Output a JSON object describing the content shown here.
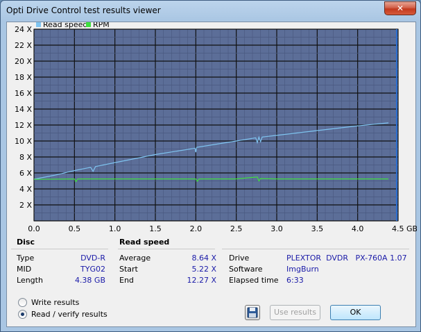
{
  "window": {
    "title": "Opti Drive Control test results viewer",
    "close_label": "✕"
  },
  "chart_data": {
    "type": "line",
    "legend": [
      {
        "name": "Read speed",
        "color": "#7fc4f0"
      },
      {
        "name": "RPM",
        "color": "#3fe03f"
      }
    ],
    "legend_position": "top-left",
    "y_ticks": [
      "24 X",
      "22 X",
      "20 X",
      "18 X",
      "16 X",
      "14 X",
      "12 X",
      "10 X",
      "8 X",
      "6 X",
      "4 X",
      "2 X"
    ],
    "x_ticks": [
      "0.0",
      "0.5",
      "1.0",
      "1.5",
      "2.0",
      "2.5",
      "3.0",
      "3.5",
      "4.0",
      "4.5 GB"
    ],
    "xlim": [
      0,
      4.5
    ],
    "ylim": [
      0,
      24
    ],
    "grid": true,
    "background_color": "#5c6e98",
    "series": [
      {
        "name": "Read speed",
        "x": [
          0.0,
          0.25,
          0.5,
          0.7,
          0.73,
          0.76,
          1.0,
          1.5,
          1.99,
          2.0,
          2.01,
          2.5,
          2.74,
          2.76,
          2.78,
          2.8,
          2.82,
          3.0,
          3.5,
          4.0,
          4.38
        ],
        "y": [
          5.22,
          5.7,
          6.3,
          6.7,
          6.2,
          6.8,
          7.3,
          8.3,
          9.1,
          8.6,
          9.2,
          10.0,
          10.4,
          9.8,
          10.5,
          9.9,
          10.5,
          10.7,
          11.3,
          11.9,
          12.27
        ]
      },
      {
        "name": "RPM",
        "x": [
          0.0,
          0.5,
          0.52,
          0.54,
          1.0,
          1.5,
          2.0,
          2.02,
          2.04,
          2.5,
          2.76,
          2.78,
          2.8,
          3.0,
          3.5,
          4.0,
          4.38
        ],
        "y": [
          5.2,
          5.25,
          4.9,
          5.25,
          5.25,
          5.25,
          5.25,
          4.95,
          5.25,
          5.25,
          5.5,
          5.0,
          5.3,
          5.25,
          5.25,
          5.25,
          5.25
        ]
      }
    ]
  },
  "disc": {
    "header": "Disc",
    "rows": [
      {
        "label": "Type",
        "value": "DVD-R"
      },
      {
        "label": "MID",
        "value": "TYG02"
      },
      {
        "label": "Length",
        "value": "4.38 GB"
      }
    ]
  },
  "read_speed": {
    "header": "Read speed",
    "rows": [
      {
        "label": "Average",
        "value": "8.64 X"
      },
      {
        "label": "Start",
        "value": "5.22 X"
      },
      {
        "label": "End",
        "value": "12.27 X"
      }
    ]
  },
  "drive_info": {
    "rows": [
      {
        "label": "Drive",
        "value": "PLEXTOR  DVDR   PX-760A 1.07"
      },
      {
        "label": "Software",
        "value": "ImgBurn"
      },
      {
        "label": "Elapsed time",
        "value": "6:33"
      }
    ]
  },
  "mode": {
    "write_label": "Write results",
    "read_label": "Read / verify results",
    "selected": "read"
  },
  "buttons": {
    "save_icon": "floppy-disk-icon",
    "use_results": "Use results",
    "ok": "OK"
  }
}
